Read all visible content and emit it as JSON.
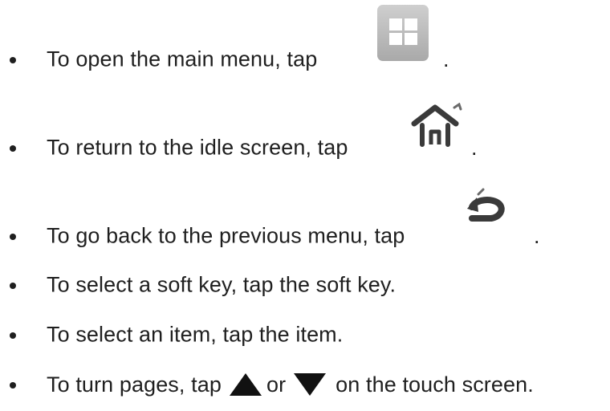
{
  "instructions": [
    {
      "text": "To open the main menu, tap",
      "suffix": ".",
      "icon": "main-menu-grid-icon"
    },
    {
      "text": "To return to the idle screen, tap",
      "suffix": ".",
      "icon": "home-icon"
    },
    {
      "text": "To go back to the previous menu, tap",
      "suffix": ".",
      "icon": "back-arrow-icon"
    },
    {
      "text": "To select a soft key, tap the soft key."
    },
    {
      "text": "To select an item, tap the item."
    },
    {
      "text_before": "To turn pages, tap",
      "text_middle": "or",
      "text_after": "on the touch screen.",
      "icons": [
        "up-triangle-icon",
        "down-triangle-icon"
      ]
    }
  ],
  "colors": {
    "text": "#1f1f1f",
    "icon_gray": "#b9b9b9",
    "icon_dark": "#3a3a3a"
  }
}
